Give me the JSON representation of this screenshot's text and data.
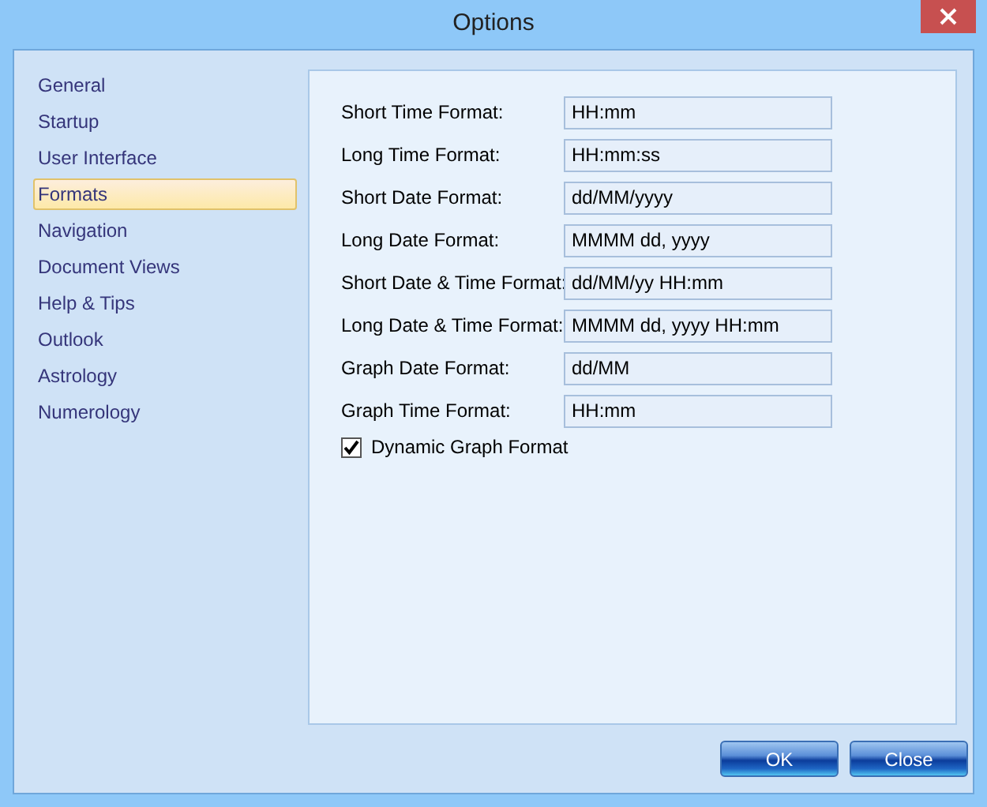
{
  "window": {
    "title": "Options"
  },
  "sidebar": {
    "items": [
      {
        "label": "General",
        "selected": false
      },
      {
        "label": "Startup",
        "selected": false
      },
      {
        "label": "User Interface",
        "selected": false
      },
      {
        "label": "Formats",
        "selected": true
      },
      {
        "label": "Navigation",
        "selected": false
      },
      {
        "label": "Document Views",
        "selected": false
      },
      {
        "label": "Help & Tips",
        "selected": false
      },
      {
        "label": "Outlook",
        "selected": false
      },
      {
        "label": "Astrology",
        "selected": false
      },
      {
        "label": "Numerology",
        "selected": false
      }
    ]
  },
  "fields": [
    {
      "label": "Short Time Format:",
      "value": "HH:mm"
    },
    {
      "label": "Long Time Format:",
      "value": "HH:mm:ss"
    },
    {
      "label": "Short Date Format:",
      "value": "dd/MM/yyyy"
    },
    {
      "label": "Long Date Format:",
      "value": "MMMM dd, yyyy"
    },
    {
      "label": "Short Date & Time Format:",
      "value": "dd/MM/yy HH:mm"
    },
    {
      "label": "Long Date & Time Format:",
      "value": "MMMM dd, yyyy HH:mm"
    },
    {
      "label": "Graph Date Format:",
      "value": "dd/MM"
    },
    {
      "label": "Graph Time Format:",
      "value": "HH:mm"
    }
  ],
  "checkbox": {
    "label": "Dynamic Graph Format",
    "checked": true
  },
  "buttons": [
    "OK",
    "Close"
  ]
}
